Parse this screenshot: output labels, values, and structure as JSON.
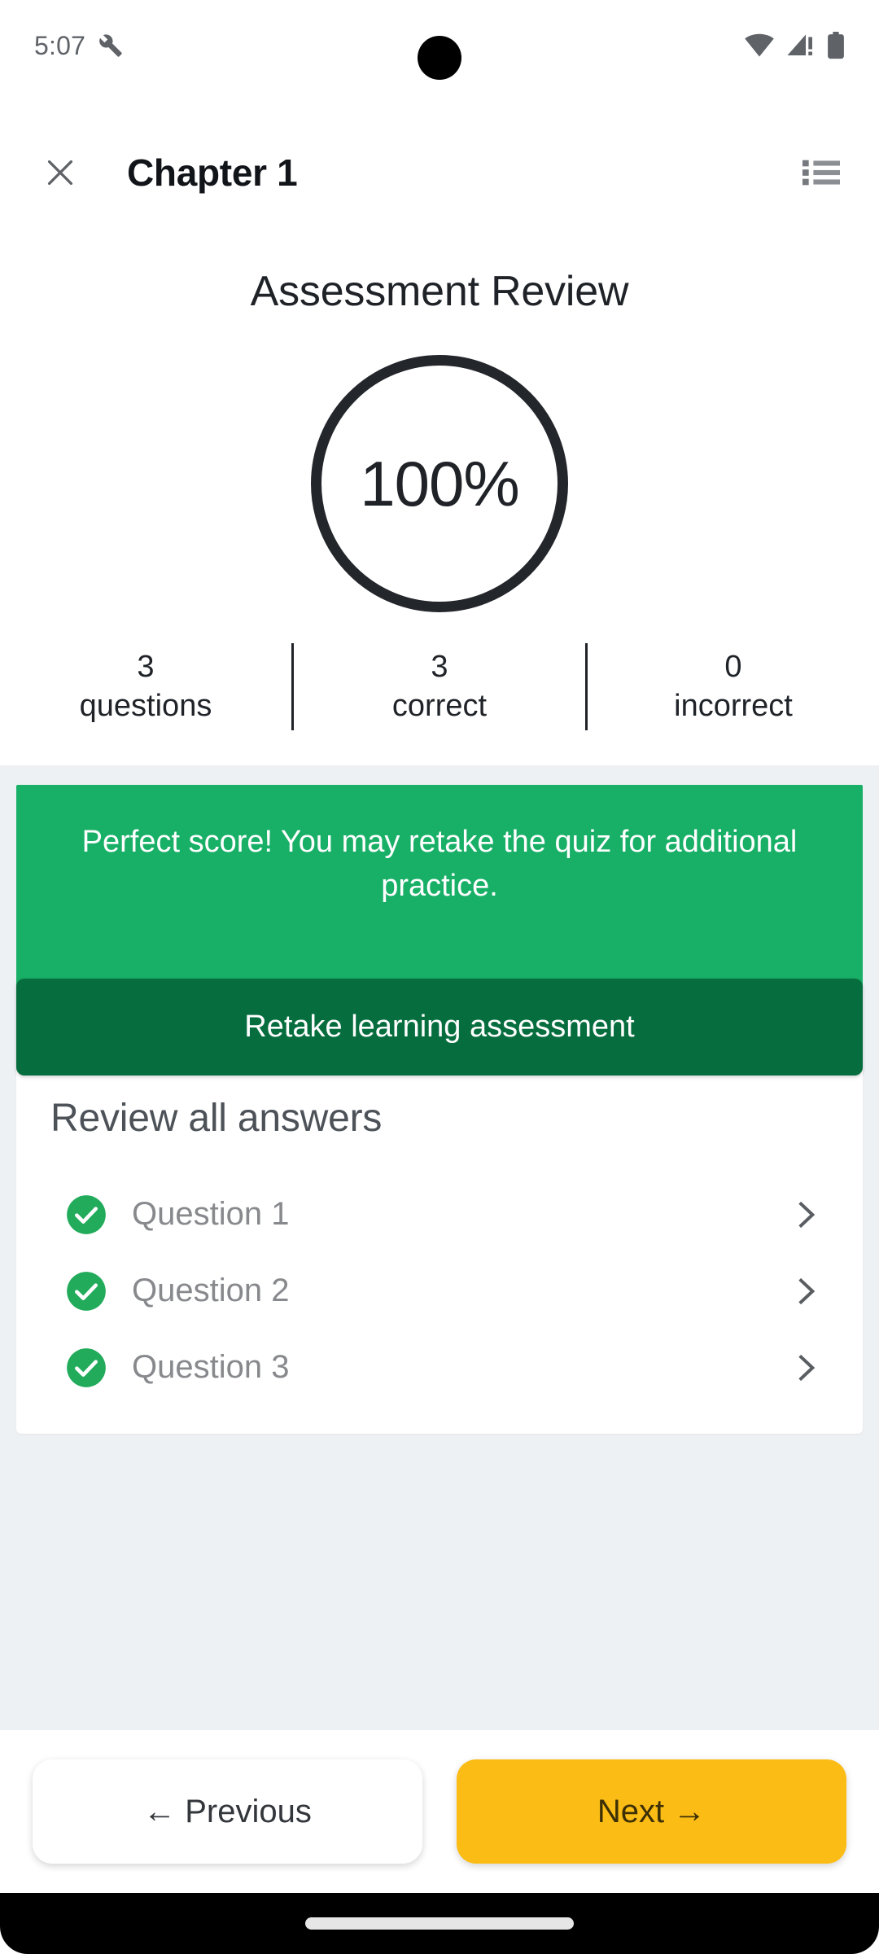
{
  "status_bar": {
    "time": "5:07",
    "icons": [
      "wrench-icon",
      "wifi-icon",
      "cellular-no-sim-icon",
      "battery-icon"
    ]
  },
  "app_bar": {
    "close_label": "close-icon",
    "title": "Chapter 1",
    "menu_label": "list-menu-icon"
  },
  "header": {
    "heading": "Assessment Review",
    "score_percent": "100%",
    "stats": [
      {
        "value": "3",
        "label": "questions"
      },
      {
        "value": "3",
        "label": "correct"
      },
      {
        "value": "0",
        "label": "incorrect"
      }
    ]
  },
  "banner": {
    "message": "Perfect score! You may retake the quiz for additional practice.",
    "retake_label": "Retake learning assessment",
    "color": "#18af66",
    "button_color": "#066e3e"
  },
  "review": {
    "title": "Review all answers",
    "questions": [
      {
        "label": "Question 1",
        "status": "correct"
      },
      {
        "label": "Question 2",
        "status": "correct"
      },
      {
        "label": "Question 3",
        "status": "correct"
      }
    ]
  },
  "footer": {
    "previous_label": "← Previous",
    "next_label": "Next →",
    "next_color": "#fbbc15"
  }
}
